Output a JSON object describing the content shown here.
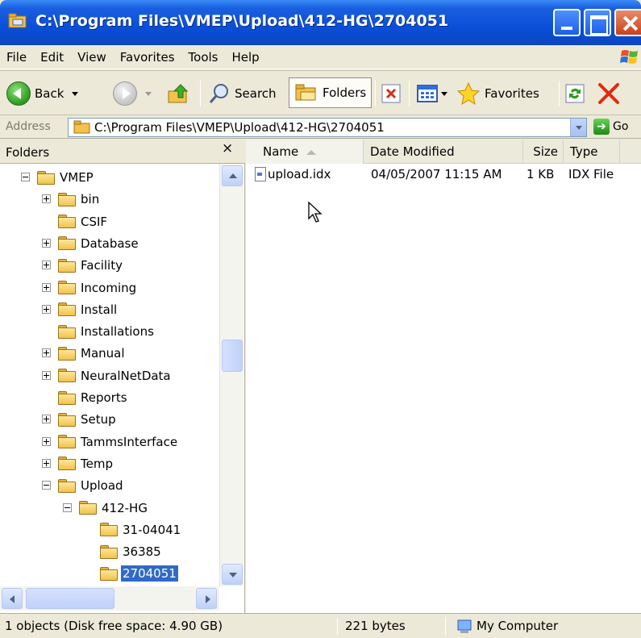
{
  "window": {
    "title": "C:\\Program Files\\VMEP\\Upload\\412-HG\\2704051"
  },
  "menu": [
    "File",
    "Edit",
    "View",
    "Favorites",
    "Tools",
    "Help"
  ],
  "toolbar": {
    "back_label": "Back",
    "search_label": "Search",
    "folders_label": "Folders",
    "favorites_label": "Favorites"
  },
  "address": {
    "label": "Address",
    "value": "C:\\Program Files\\VMEP\\Upload\\412-HG\\2704051",
    "go_label": "Go"
  },
  "folder_pane": {
    "title": "Folders",
    "close_glyph": "×",
    "tree": [
      {
        "label": "VMEP",
        "expander": "minus"
      },
      {
        "label": "bin",
        "expander": "plus"
      },
      {
        "label": "CSIF",
        "expander": "none"
      },
      {
        "label": "Database",
        "expander": "plus"
      },
      {
        "label": "Facility",
        "expander": "plus"
      },
      {
        "label": "Incoming",
        "expander": "plus"
      },
      {
        "label": "Install",
        "expander": "plus"
      },
      {
        "label": "Installations",
        "expander": "none"
      },
      {
        "label": "Manual",
        "expander": "plus"
      },
      {
        "label": "NeuralNetData",
        "expander": "plus"
      },
      {
        "label": "Reports",
        "expander": "none"
      },
      {
        "label": "Setup",
        "expander": "plus"
      },
      {
        "label": "TammsInterface",
        "expander": "plus"
      },
      {
        "label": "Temp",
        "expander": "plus"
      },
      {
        "label": "Upload",
        "expander": "minus"
      },
      {
        "label": "412-HG",
        "expander": "minus"
      },
      {
        "label": "31-04041",
        "expander": "none"
      },
      {
        "label": "36385",
        "expander": "none"
      },
      {
        "label": "2704051",
        "expander": "none",
        "selected": true
      }
    ]
  },
  "file_list": {
    "columns": [
      "Name",
      "Date Modified",
      "Size",
      "Type"
    ],
    "rows": [
      {
        "name": "upload.idx",
        "date": "04/05/2007 11:15 AM",
        "size": "1 KB",
        "type": "IDX File"
      }
    ]
  },
  "status": {
    "objects": "1 objects (Disk free space: 4.90 GB)",
    "size": "221 bytes",
    "zone": "My Computer"
  },
  "colors": {
    "titlebar": "#0a4fd8",
    "selection": "#316ac5",
    "chrome": "#ece9d8"
  }
}
